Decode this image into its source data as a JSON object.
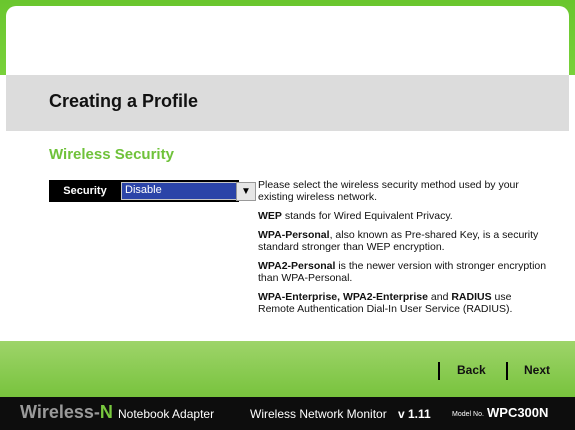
{
  "header": {
    "title": "Creating a Profile"
  },
  "section": {
    "title": "Wireless Security"
  },
  "security": {
    "label": "Security",
    "selected": "Disable",
    "dropdown_icon": "triangle-down-icon"
  },
  "description": {
    "p1": "Please select the wireless security method used by your existing wireless network.",
    "p2_bold": "WEP",
    "p2_rest": " stands for Wired Equivalent Privacy.",
    "p3_bold": "WPA-Personal",
    "p3_rest": ", also known as Pre-shared Key, is a security standard stronger than WEP encryption.",
    "p4_bold": "WPA2-Personal",
    "p4_rest": " is the newer version with stronger encryption than WPA-Personal.",
    "p5_bold1": "WPA-Enterprise, WPA2-Enterprise",
    "p5_and": " and ",
    "p5_bold2": "RADIUS",
    "p5_rest": " use Remote Authentication Dial-In User Service (RADIUS)."
  },
  "nav": {
    "back": "Back",
    "next": "Next"
  },
  "footer": {
    "brand_main": "Wireless-",
    "brand_accent": "N",
    "product": "Notebook Adapter",
    "monitor": "Wireless Network Monitor",
    "version": "v 1.11",
    "model_label": "Model No.",
    "model": "WPC300N"
  },
  "colors": {
    "accent_green": "#6fc23a",
    "select_blue": "#2b44a8",
    "footer_bg": "#0d0d0d"
  }
}
